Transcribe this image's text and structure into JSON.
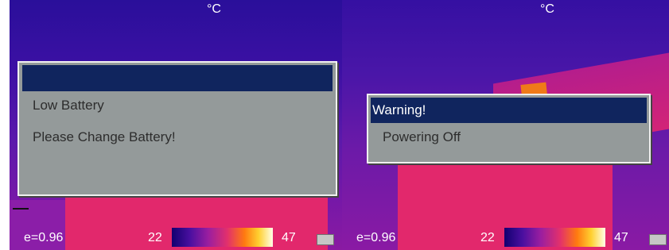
{
  "screens": [
    {
      "unit": "°C",
      "dialog": {
        "title": "",
        "lines": [
          "Low Battery",
          "Please Change Battery!"
        ]
      },
      "status": {
        "emissivity": "e=0.96",
        "temp_min": "22",
        "temp_max": "47"
      }
    },
    {
      "unit": "°C",
      "dialog": {
        "title": "Warning!",
        "lines": [
          "Powering Off"
        ]
      },
      "status": {
        "emissivity": "e=0.96",
        "temp_min": "22",
        "temp_max": "47"
      }
    }
  ],
  "colors": {
    "dialog_title_bg": "#10255e",
    "dialog_body_bg": "#949a9a",
    "dialog_text": "#2d2d2d",
    "hot_region": "#e2286c"
  },
  "icons": {
    "battery": "battery-icon",
    "palette": "color-palette-bar"
  }
}
